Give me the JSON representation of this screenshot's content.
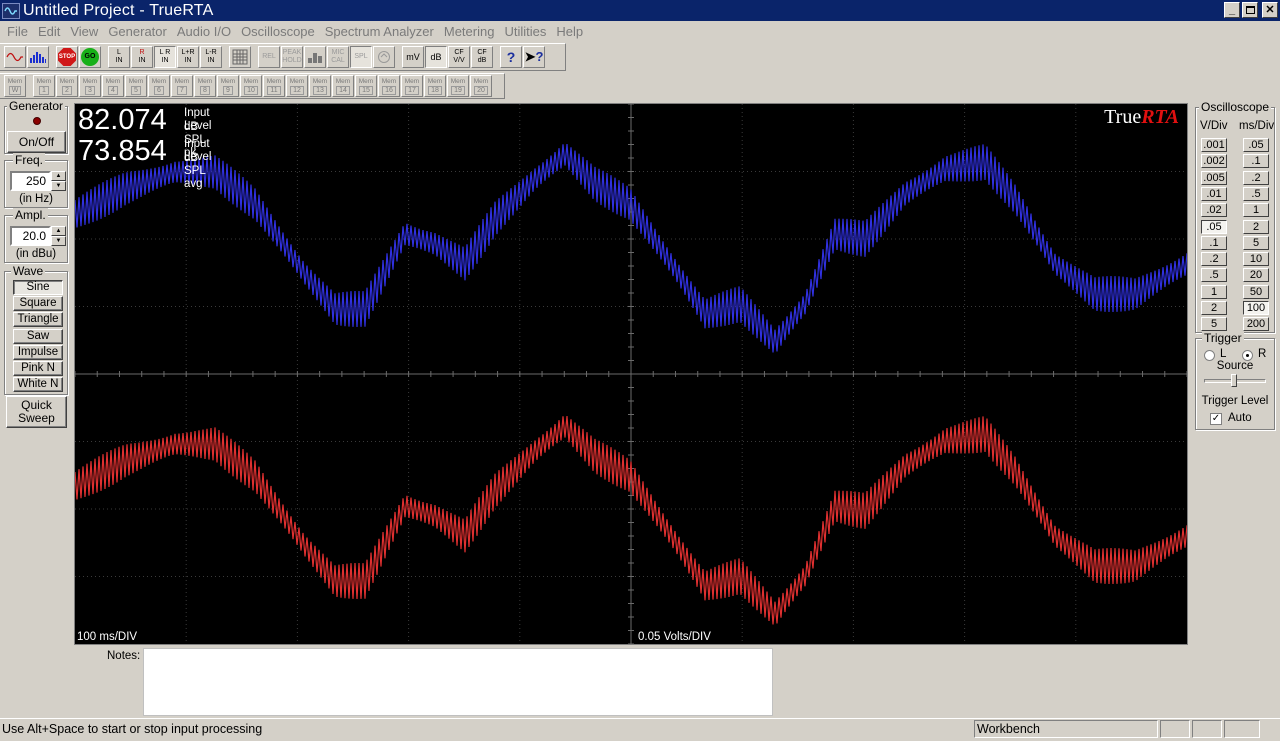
{
  "window": {
    "title": "Untitled Project - TrueRTA"
  },
  "menu": [
    "File",
    "Edit",
    "View",
    "Generator",
    "Audio I/O",
    "Oscilloscope",
    "Spectrum Analyzer",
    "Metering",
    "Utilities",
    "Help"
  ],
  "toolbar": {
    "buttons": [
      {
        "name": "oscilloscope-view-button",
        "lines": [
          ""
        ]
      },
      {
        "name": "spectrum-view-button",
        "lines": [
          ""
        ]
      },
      {
        "name": "stop-button",
        "lines": [
          "STOP"
        ]
      },
      {
        "name": "go-button",
        "lines": [
          "GO"
        ]
      },
      {
        "name": "left-in-button",
        "lines": [
          "L",
          "IN"
        ]
      },
      {
        "name": "right-in-button",
        "lines": [
          "R",
          "IN"
        ]
      },
      {
        "name": "left-right-in-button",
        "lines": [
          "L R",
          "IN"
        ]
      },
      {
        "name": "left-plus-right-in-button",
        "lines": [
          "L+R",
          "IN"
        ]
      },
      {
        "name": "left-minus-right-in-button",
        "lines": [
          "L-R",
          "IN"
        ]
      },
      {
        "name": "grid-button",
        "lines": [
          ""
        ]
      },
      {
        "name": "rel-button",
        "lines": [
          "REL"
        ]
      },
      {
        "name": "peak-hold-button",
        "lines": [
          "PEAK",
          "HOLD"
        ]
      },
      {
        "name": "bars-button",
        "lines": [
          ""
        ]
      },
      {
        "name": "mic-cal-button",
        "lines": [
          "MIC",
          "CAL"
        ]
      },
      {
        "name": "spl-button",
        "lines": [
          "SPL"
        ]
      },
      {
        "name": "weighting-button",
        "lines": [
          ""
        ]
      },
      {
        "name": "mv-button",
        "lines": [
          "mV"
        ]
      },
      {
        "name": "db-button",
        "lines": [
          "dB"
        ]
      },
      {
        "name": "cf-vv-button",
        "lines": [
          "CF",
          "V/V"
        ]
      },
      {
        "name": "cf-db-button",
        "lines": [
          "CF",
          "dB"
        ]
      },
      {
        "name": "help-button",
        "lines": [
          "?"
        ]
      },
      {
        "name": "context-help-button",
        "lines": [
          "?"
        ]
      }
    ],
    "memory": [
      {
        "top": "Mem",
        "num": "W"
      },
      {
        "top": "Mem",
        "num": "1"
      },
      {
        "top": "Mem",
        "num": "2"
      },
      {
        "top": "Mem",
        "num": "3"
      },
      {
        "top": "Mem",
        "num": "4"
      },
      {
        "top": "Mem",
        "num": "5"
      },
      {
        "top": "Mem",
        "num": "6"
      },
      {
        "top": "Mem",
        "num": "7"
      },
      {
        "top": "Mem",
        "num": "8"
      },
      {
        "top": "Mem",
        "num": "9"
      },
      {
        "top": "Mem",
        "num": "10"
      },
      {
        "top": "Mem",
        "num": "11"
      },
      {
        "top": "Mem",
        "num": "12"
      },
      {
        "top": "Mem",
        "num": "13"
      },
      {
        "top": "Mem",
        "num": "14"
      },
      {
        "top": "Mem",
        "num": "15"
      },
      {
        "top": "Mem",
        "num": "16"
      },
      {
        "top": "Mem",
        "num": "17"
      },
      {
        "top": "Mem",
        "num": "18"
      },
      {
        "top": "Mem",
        "num": "19"
      },
      {
        "top": "Mem",
        "num": "20"
      }
    ]
  },
  "generator": {
    "title": "Generator",
    "onoff_label": "On/Off",
    "freq_title": "Freq.",
    "freq_value": "250",
    "freq_unit": "(in Hz)",
    "ampl_title": "Ampl.",
    "ampl_value": "20.0",
    "ampl_unit": "(in dBu)",
    "wave_title": "Wave",
    "waves": [
      "Sine",
      "Square",
      "Triangle",
      "Saw",
      "Impulse",
      "Pink N",
      "White N"
    ],
    "selected_wave": "Sine",
    "quick_sweep_label": "Quick Sweep"
  },
  "scope": {
    "peak_value": "82.074",
    "peak_label1": "Input Level",
    "peak_label2": "dB SPL pk",
    "avg_value": "73.854",
    "avg_label1": "Input Level",
    "avg_label2": "dB SPL avg",
    "brand_plain": "True",
    "brand_accent": "RTA",
    "time_div": "100  ms/DIV",
    "volts_div": "0.05   Volts/DIV",
    "colors": {
      "left_trace": "#3030e0",
      "right_trace": "#e03030",
      "grid": "#3a3a3a",
      "axis": "#6a6a6a"
    }
  },
  "notes": {
    "label": "Notes:",
    "value": ""
  },
  "oscilloscope_panel": {
    "title": "Oscilloscope",
    "vdiv_label": "V/Div",
    "msdiv_label": "ms/Div",
    "vdiv_options": [
      ".001",
      ".002",
      ".005",
      ".01",
      ".02",
      ".05",
      ".1",
      ".2",
      ".5",
      "1",
      "2",
      "5"
    ],
    "vdiv_selected": ".05",
    "msdiv_options": [
      ".05",
      ".1",
      ".2",
      ".5",
      "1",
      "2",
      "5",
      "10",
      "20",
      "50",
      "100",
      "200"
    ],
    "msdiv_selected": "100",
    "trigger_title": "Trigger",
    "radio_l": "L",
    "radio_r": "R",
    "trigger_source_selected": "R",
    "source_label": "Source",
    "trigger_level_label": "Trigger Level",
    "auto_label": "Auto",
    "auto_checked": true
  },
  "status": {
    "message": "Use Alt+Space to start or stop input processing",
    "pane_label": "Workbench"
  }
}
